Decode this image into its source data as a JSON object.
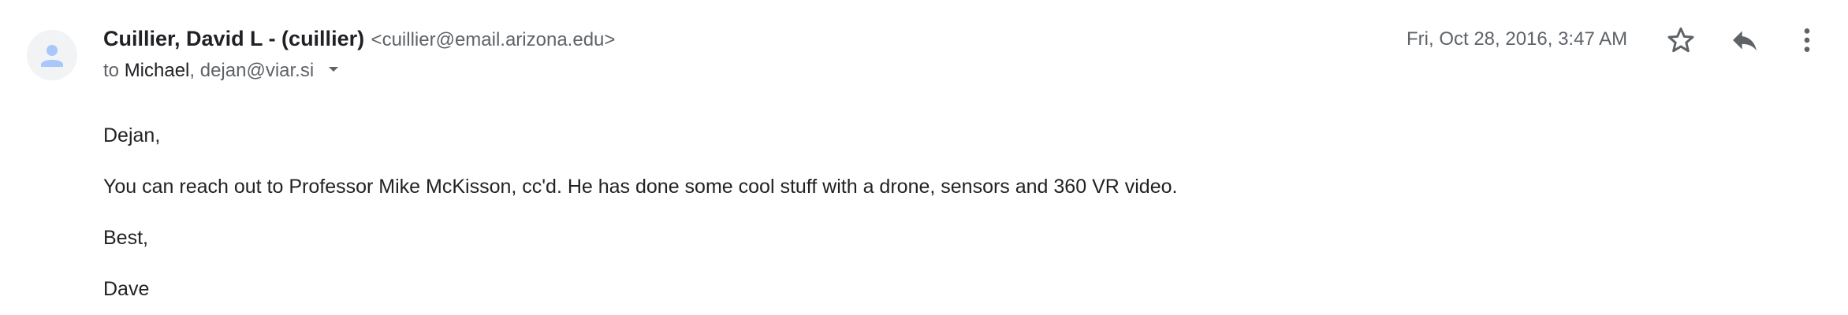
{
  "message": {
    "sender": {
      "name": "Cuillier, David L - (cuillier)",
      "email": "<cuillier@email.arizona.edu>",
      "avatar_icon": "person-icon"
    },
    "recipients": {
      "prefix": "to",
      "primary": "Michael",
      "separator": ",",
      "secondary": "dejan@viar.si",
      "expand_icon": "chevron-down-icon"
    },
    "date": "Fri, Oct 28, 2016, 3:47 AM",
    "actions": {
      "star_icon": "star-outline-icon",
      "reply_icon": "reply-icon",
      "more_icon": "more-vert-icon"
    },
    "body": {
      "paragraphs": [
        "Dejan,",
        "You can reach out to Professor Mike McKisson, cc'd. He has done some cool stuff with a drone, sensors and 360 VR video.",
        "Best,",
        "Dave"
      ]
    }
  },
  "colors": {
    "text_primary": "#202124",
    "text_secondary": "#5f6368",
    "avatar_bg": "#f1f3f4",
    "avatar_fg": "#a8c7fa",
    "icon": "#5f6368"
  }
}
